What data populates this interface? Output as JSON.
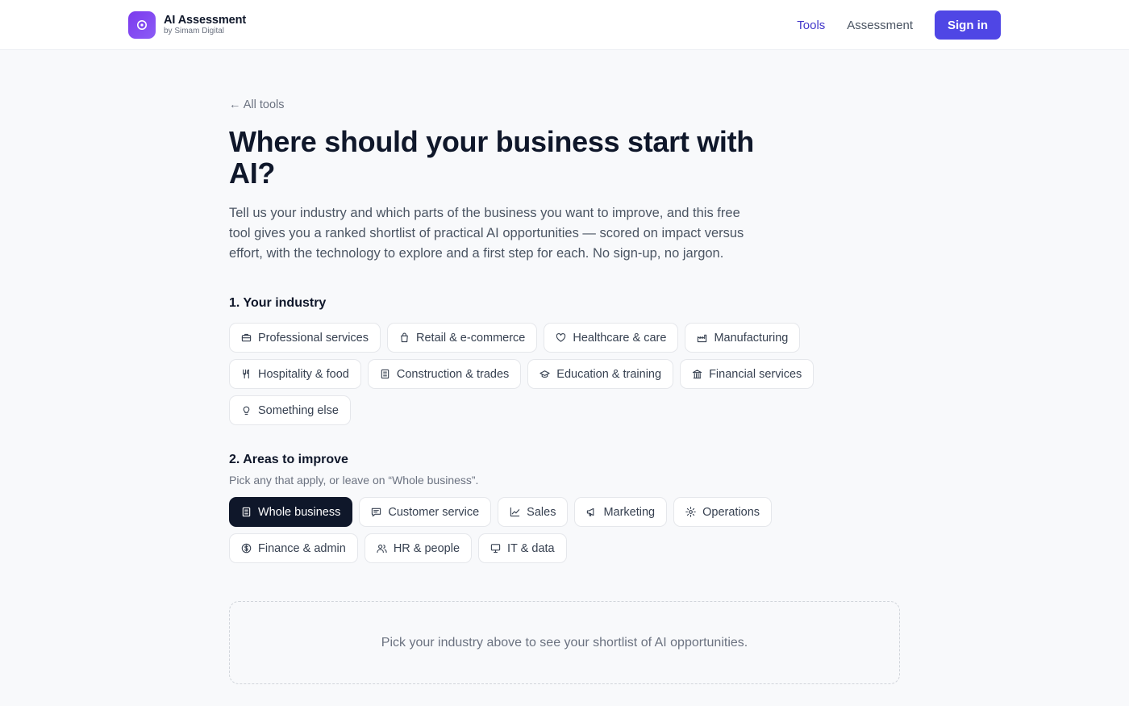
{
  "header": {
    "brand_title": "AI Assessment",
    "brand_sub": "by Simam Digital",
    "nav": [
      {
        "label": "Tools",
        "active": true
      },
      {
        "label": "Assessment",
        "active": false
      }
    ],
    "signin_label": "Sign in"
  },
  "colors": {
    "accent": "#4f46e5",
    "brand_gradient_start": "#7c3aed",
    "selected_chip": "#0f172a"
  },
  "main": {
    "back_label": "← All tools",
    "title": "Where should your business start with AI?",
    "intro": "Tell us your industry and which parts of the business you want to improve, and this free tool gives you a ranked shortlist of practical AI opportunities — scored on impact versus effort, with the technology to explore and a first step for each. No sign-up, no jargon.",
    "industry": {
      "title": "1. Your industry",
      "options": [
        {
          "label": "Professional services",
          "icon": "briefcase-icon",
          "selected": false
        },
        {
          "label": "Retail & e-commerce",
          "icon": "shopping-bag-icon",
          "selected": false
        },
        {
          "label": "Healthcare & care",
          "icon": "heart-icon",
          "selected": false
        },
        {
          "label": "Manufacturing",
          "icon": "factory-icon",
          "selected": false
        },
        {
          "label": "Hospitality & food",
          "icon": "utensils-icon",
          "selected": false
        },
        {
          "label": "Construction & trades",
          "icon": "building-icon",
          "selected": false
        },
        {
          "label": "Education & training",
          "icon": "graduation-cap-icon",
          "selected": false
        },
        {
          "label": "Financial services",
          "icon": "bank-icon",
          "selected": false
        },
        {
          "label": "Something else",
          "icon": "lightbulb-icon",
          "selected": false
        }
      ]
    },
    "areas": {
      "title": "2. Areas to improve",
      "hint": "Pick any that apply, or leave on “Whole business”.",
      "options": [
        {
          "label": "Whole business",
          "icon": "building-icon",
          "selected": true
        },
        {
          "label": "Customer service",
          "icon": "chat-icon",
          "selected": false
        },
        {
          "label": "Sales",
          "icon": "chart-line-icon",
          "selected": false
        },
        {
          "label": "Marketing",
          "icon": "megaphone-icon",
          "selected": false
        },
        {
          "label": "Operations",
          "icon": "gear-icon",
          "selected": false
        },
        {
          "label": "Finance & admin",
          "icon": "dollar-icon",
          "selected": false
        },
        {
          "label": "HR & people",
          "icon": "users-icon",
          "selected": false
        },
        {
          "label": "IT & data",
          "icon": "monitor-icon",
          "selected": false
        }
      ]
    },
    "empty_state": "Pick your industry above to see your shortlist of AI opportunities."
  }
}
